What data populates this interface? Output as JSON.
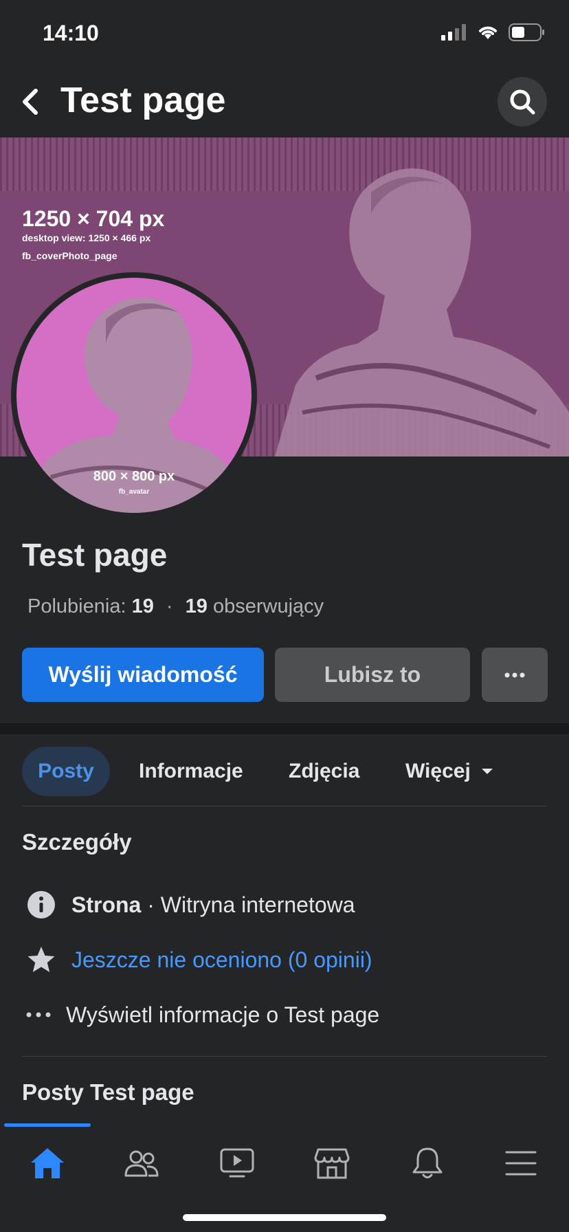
{
  "status_bar": {
    "time": "14:10"
  },
  "header": {
    "title": "Test page"
  },
  "cover": {
    "size_text": "1250 × 704 px",
    "desktop_text": "desktop view: 1250 × 466 px",
    "name_text": "fb_coverPhoto_page"
  },
  "avatar": {
    "size_text": "800 × 800 px",
    "name_text": "fb_avatar"
  },
  "page": {
    "name": "Test page",
    "likes_label": "Polubienia:",
    "likes_count": "19",
    "dot": "·",
    "followers_count": "19",
    "followers_label": "obserwujący"
  },
  "actions": {
    "message": "Wyślij wiadomość",
    "like": "Lubisz to",
    "more": "···"
  },
  "tabs": [
    {
      "label": "Posty"
    },
    {
      "label": "Informacje"
    },
    {
      "label": "Zdjęcia"
    },
    {
      "label": "Więcej"
    }
  ],
  "details": {
    "title": "Szczegóły",
    "category_bold": "Strona",
    "category_rest": " · Witryna internetowa",
    "rating": "Jeszcze nie oceniono (0 opinii)",
    "see_info": "Wyświetl informacje o Test page"
  },
  "posts": {
    "title": "Posty Test page"
  },
  "colors": {
    "accent": "#1b74e4",
    "link": "#4599ff",
    "background": "#242526",
    "cover": "#7e4672",
    "avatar_bg": "#d56fc5"
  }
}
